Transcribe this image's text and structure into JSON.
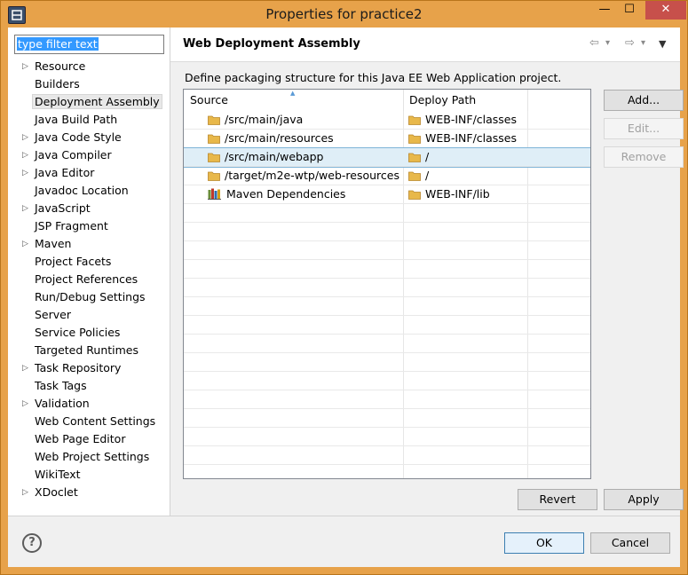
{
  "window": {
    "title": "Properties for practice2",
    "min_glyph": "—",
    "max_glyph": "☐",
    "close_glyph": "✕"
  },
  "filter": {
    "value": "type filter text"
  },
  "sidebar": {
    "items": [
      {
        "label": "Resource",
        "expandable": true
      },
      {
        "label": "Builders",
        "expandable": false
      },
      {
        "label": "Deployment Assembly",
        "expandable": false,
        "selected": true
      },
      {
        "label": "Java Build Path",
        "expandable": false
      },
      {
        "label": "Java Code Style",
        "expandable": true
      },
      {
        "label": "Java Compiler",
        "expandable": true
      },
      {
        "label": "Java Editor",
        "expandable": true
      },
      {
        "label": "Javadoc Location",
        "expandable": false
      },
      {
        "label": "JavaScript",
        "expandable": true
      },
      {
        "label": "JSP Fragment",
        "expandable": false
      },
      {
        "label": "Maven",
        "expandable": true
      },
      {
        "label": "Project Facets",
        "expandable": false
      },
      {
        "label": "Project References",
        "expandable": false
      },
      {
        "label": "Run/Debug Settings",
        "expandable": false
      },
      {
        "label": "Server",
        "expandable": false
      },
      {
        "label": "Service Policies",
        "expandable": false
      },
      {
        "label": "Targeted Runtimes",
        "expandable": false
      },
      {
        "label": "Task Repository",
        "expandable": true
      },
      {
        "label": "Task Tags",
        "expandable": false
      },
      {
        "label": "Validation",
        "expandable": true
      },
      {
        "label": "Web Content Settings",
        "expandable": false
      },
      {
        "label": "Web Page Editor",
        "expandable": false
      },
      {
        "label": "Web Project Settings",
        "expandable": false
      },
      {
        "label": "WikiText",
        "expandable": false
      },
      {
        "label": "XDoclet",
        "expandable": true
      }
    ]
  },
  "page": {
    "title": "Web Deployment Assembly",
    "description": "Define packaging structure for this Java EE Web Application project.",
    "nav": {
      "back": "⇦",
      "back_menu": "▾",
      "forward": "⇨",
      "forward_menu": "▾",
      "view_menu": "▼"
    }
  },
  "table": {
    "columns": [
      "Source",
      "Deploy Path"
    ],
    "rows": [
      {
        "source": "/src/main/java",
        "deploy": "WEB-INF/classes",
        "icon": "folder-icon"
      },
      {
        "source": "/src/main/resources",
        "deploy": "WEB-INF/classes",
        "icon": "folder-icon"
      },
      {
        "source": "/src/main/webapp",
        "deploy": "/",
        "icon": "folder-icon",
        "selected": true
      },
      {
        "source": "/target/m2e-wtp/web-resources",
        "deploy": "/",
        "icon": "folder-icon"
      },
      {
        "source": "Maven Dependencies",
        "deploy": "WEB-INF/lib",
        "icon": "library-icon"
      }
    ]
  },
  "buttons": {
    "add": "Add...",
    "edit": "Edit...",
    "remove": "Remove",
    "revert": "Revert",
    "apply": "Apply",
    "ok": "OK",
    "cancel": "Cancel",
    "help": "?"
  },
  "colors": {
    "titlebar": "#e7a24a",
    "close": "#c7504b",
    "selection": "#3399ff",
    "row_selected": "#dfeef7",
    "folder": "#e8b84a"
  }
}
